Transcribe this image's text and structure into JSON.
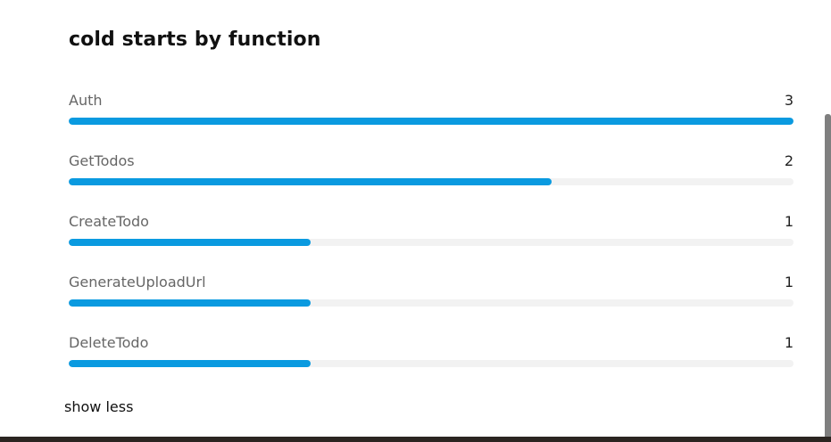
{
  "panel": {
    "title": "cold starts by function",
    "show_toggle_label": "show less",
    "bar_color": "#0a9ae0",
    "track_color": "#f2f2f2"
  },
  "rows": [
    {
      "label": "Auth",
      "value": "3",
      "fraction": 1.0
    },
    {
      "label": "GetTodos",
      "value": "2",
      "fraction": 0.6667
    },
    {
      "label": "CreateTodo",
      "value": "1",
      "fraction": 0.3333
    },
    {
      "label": "GenerateUploadUrl",
      "value": "1",
      "fraction": 0.3333
    },
    {
      "label": "DeleteTodo",
      "value": "1",
      "fraction": 0.3333
    }
  ]
}
